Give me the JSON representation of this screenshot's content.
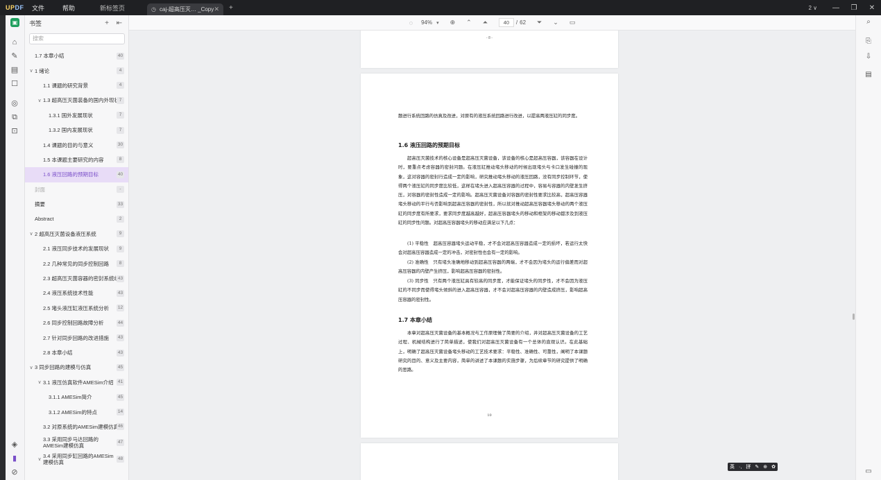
{
  "app": {
    "logo_a": "UP",
    "logo_b": "DF",
    "menu": [
      "文件",
      "帮助"
    ],
    "new_tab_link": "新标签页",
    "doc_tab": "caj-超高压灭… _Copy(1)",
    "account": "2 ∨"
  },
  "sidebar": {
    "title": "书签",
    "search_placeholder": "搜索",
    "items": [
      {
        "label": "1.7 本章小结",
        "page": "40",
        "level": "lv1b",
        "chev": ""
      },
      {
        "label": "1 绪论",
        "page": "4",
        "level": "lv0",
        "chev": "∨"
      },
      {
        "label": "1.1 课题的研究背景",
        "page": "4",
        "level": "lv1",
        "chev": ""
      },
      {
        "label": "1.3 超高压灭菌装备的国内外现状",
        "page": "7",
        "level": "lv1",
        "chev": "∨"
      },
      {
        "label": "1.3.1 国外发展现状",
        "page": "7",
        "level": "lv2",
        "chev": ""
      },
      {
        "label": "1.3.2 国内发展现状",
        "page": "7",
        "level": "lv2",
        "chev": ""
      },
      {
        "label": "1.4 课题的目的与意义",
        "page": "30",
        "level": "lv1",
        "chev": ""
      },
      {
        "label": "1.5 本课题主要研究的内容",
        "page": "8",
        "level": "lv1",
        "chev": ""
      },
      {
        "label": "1.6 液压回路的预期目标",
        "page": "40",
        "level": "lv1",
        "chev": "",
        "active": true
      },
      {
        "label": "封面",
        "page": "-",
        "level": "lv1b",
        "chev": "",
        "muted": true
      },
      {
        "label": "摘要",
        "page": "33",
        "level": "lv1b",
        "chev": ""
      },
      {
        "label": "Abstract",
        "page": "2",
        "level": "lv1b",
        "chev": ""
      },
      {
        "label": "2 超高压灭菌设备液压系统",
        "page": "9",
        "level": "lv0",
        "chev": "∨"
      },
      {
        "label": "2.1 液压同步技术的发展现状",
        "page": "9",
        "level": "lv1",
        "chev": ""
      },
      {
        "label": "2.2 几种常见的同步控制回路",
        "page": "8",
        "level": "lv1",
        "chev": ""
      },
      {
        "label": "2.3 超高压灭菌容器的密封系统组成",
        "page": "43",
        "level": "lv1",
        "chev": ""
      },
      {
        "label": "2.4 液压系统技术性能",
        "page": "43",
        "level": "lv1",
        "chev": ""
      },
      {
        "label": "2.5 堵头液压缸液压系统分析",
        "page": "12",
        "level": "lv1",
        "chev": ""
      },
      {
        "label": "2.6 同步控制回路故障分析",
        "page": "44",
        "level": "lv1",
        "chev": ""
      },
      {
        "label": "2.7 针对同步回路的改进措施",
        "page": "43",
        "level": "lv1",
        "chev": ""
      },
      {
        "label": "2.8 本章小结",
        "page": "43",
        "level": "lv1",
        "chev": ""
      },
      {
        "label": "3 同步回路的建模与仿真",
        "page": "45",
        "level": "lv0",
        "chev": "∨"
      },
      {
        "label": "3.1 液压仿真软件AMESim介绍",
        "page": "41",
        "level": "lv1",
        "chev": "∨"
      },
      {
        "label": "3.1.1 AMESim简介",
        "page": "45",
        "level": "lv2",
        "chev": ""
      },
      {
        "label": "3.1.2 AMESim的特点",
        "page": "14",
        "level": "lv2",
        "chev": ""
      },
      {
        "label": "3.2 对原系统的AMESim建模仿真",
        "page": "46",
        "level": "lv1",
        "chev": ""
      },
      {
        "label": "3.3 采用同步马达回路的AMESim建模仿真",
        "page": "47",
        "level": "lv1",
        "chev": "",
        "two": true
      },
      {
        "label": "3.4 采用同步缸回路的AMESim建模仿真",
        "page": "48",
        "level": "lv1",
        "chev": "∨",
        "two": true
      }
    ]
  },
  "toolbar": {
    "zoom": "94%",
    "current_page": "40",
    "page_sep": "/",
    "total_pages": "62"
  },
  "document": {
    "prev_page_num": "- 8 -",
    "page_num": "10",
    "p_intro": "题进行系统回路的仿真及改进，对原有的液压系统回路进行改进，以提高两液压缸的同步度。",
    "h_16": "1.6 液压回路的预期目标",
    "p_16": "超高压灭菌技术的核心设备是超高压灭菌设备，该设备的核心是超高压容器，该容器在设计时，要重点考虑容器的密封问题。在液压缸推动堵头移动的时候出现堵头与卡口发生碰撞的现象，这对容器的密封行造成一定的影响，研究推动堵头移动的液压回路，没有同步控制环节，使得两个液压缸的同步度比较低，这样在堵头进入超高压容器的过程中，容易与容器的内壁发生挤压，对容器的密封性造成一定的影响。超高压灭菌设备对容器的密封性要求比较高，超高压容器堵头移动的平行与否影响到超高压容器的密封性，所以就对推动超高压容器堵头移动的两个液压缸的同步度有所要求，要求同步度越高越好，超高压容器堵头的移动和框架的移动都涉及到液压缸的同步性问题。对超高压容器堵头的移动应满足以下几点：",
    "p_pt1": "(1) 平稳性　超高压容器堵头运动平稳，才不会对超高压容器造成一定的损坏，若运行太快会对超高压容器造成一定的冲击，对密封性也会有一定的影响。",
    "p_pt2": "(2) 准确性　只有堵头准确地移动到超高压容器的两端，才不会因为堵头的运行偏差而对超高压容器的内壁产生挤压，影响超高压容器的密封性。",
    "p_pt3": "(3) 同步性　只有两个液压缸具有较高的同步度，才能保证堵头的同步性，才不会因为液压缸的不同步而使得堵头倾斜的进入超高压容器，才不会对超高压容器的内壁造成挤压，影响超高压容器的密封性。",
    "h_17": "1.7 本章小结",
    "p_17": "本章对超高压灭菌设备的基本概况与工作原理做了简要的介绍，并对超高压灭菌设备的工艺过程、机械结构进行了简单描述，使我们对超高压灭菌设备有一个总体的直观认识。在此基础上，明确了超高压灭菌设备堵头移动的工艺技术要求：平稳性、准确性、可靠性，阐明了本课题研究的目的、意义及主要内容，简单的讲述了本课题的实施步骤，为后续章节的研究提供了明确的思路。"
  },
  "ime": {
    "items": [
      "英",
      "·,",
      "拼",
      "✎",
      "⊕",
      "✿"
    ]
  },
  "colors": {
    "accent": "#7a4fc9",
    "active_bg": "#e8dcf7",
    "titlebar": "#1f2023",
    "brand_green": "#1f9f5e"
  }
}
